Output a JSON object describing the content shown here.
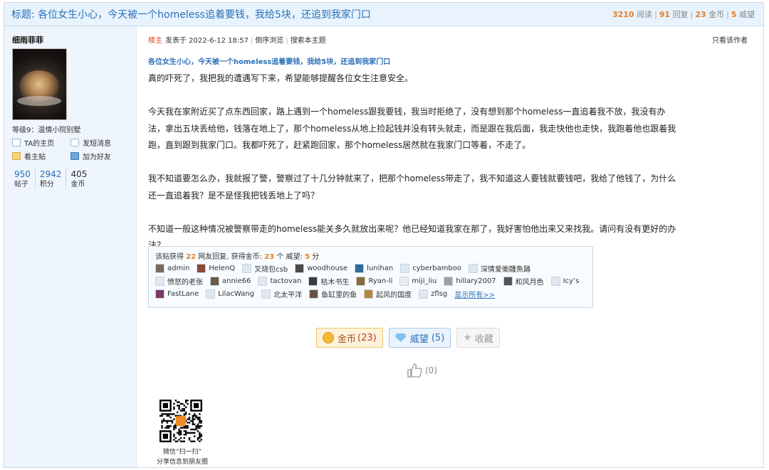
{
  "thread": {
    "title": "标题: 各位女生小心，今天被一个homeless追着要钱，我给5块，还追到我家门口",
    "stats": [
      {
        "num": "3210",
        "label": "阅读"
      },
      {
        "num": "91",
        "label": "回复"
      },
      {
        "num": "23",
        "label": "金币"
      },
      {
        "num": "5",
        "label": "威望"
      }
    ]
  },
  "author": {
    "name": "细雨菲菲",
    "level": "等级9：温情小院别墅",
    "links": [
      "TA的主页",
      "发短消息",
      "看主贴",
      "加为好友"
    ],
    "counts": [
      {
        "num": "950",
        "label": "帖子"
      },
      {
        "num": "2942",
        "label": "积分"
      },
      {
        "num": "405",
        "label": "金币"
      }
    ]
  },
  "post": {
    "floor": "楼主",
    "posted": "发表于 2022-6-12 18:57",
    "reverse": "倒序浏览",
    "search": "搜索本主题",
    "only_author": "只看该作者",
    "subtitle": "各位女生小心，今天被一个homeless追着要钱，我给5块，还追到我家门口",
    "paragraphs": [
      "真的吓死了，我把我的遭遇写下来，希望能够提醒各位女生注意安全。",
      "今天我在家附近买了点东西回家，路上遇到一个homeless跟我要钱，我当时拒绝了，没有想到那个homeless一直追着我不放，我没有办法，拿出五块丢给他，钱落在地上了，那个homeless从地上捡起钱并没有转头就走，而是跟在我后面，我走快他也走快，我跑着他也跟着我跑，直到跟到我家门口。我都吓死了，赶紧跑回家，那个homeless居然就在我家门口等着，不走了。",
      "我不知道要怎么办，我就报了警，警察过了十几分钟就来了，把那个homeless带走了，我不知道这人要钱就要钱吧，我给了他钱了，为什么还一直追着我？是不是怪我把钱丢地上了吗？",
      "不知道一般这种情况被警察带走的homeless能关多久就放出来呢？他已经知道我家在那了，我好害怕他出来又来找我。请问有没有更好的办法？"
    ]
  },
  "rating": {
    "p1": "该贴获得",
    "replies": "22",
    "p2": "网友回复, 获得金币:",
    "gold": "23",
    "p3": "个 威望:",
    "prestige": "5",
    "p4": "分",
    "users": [
      {
        "name": "admin",
        "color": "#7a6a5c"
      },
      {
        "name": "HelenQ",
        "color": "#8b4a3b"
      },
      {
        "name": "叉烧包csb",
        "color": "#dfe8f0"
      },
      {
        "name": "woodhouse",
        "color": "#4a4a4a"
      },
      {
        "name": "lunihan",
        "color": "#2d6b9a"
      },
      {
        "name": "cyberbamboo",
        "color": "#dfe8f0"
      },
      {
        "name": "深情爱衝鸌魚踊",
        "color": "#dfe8f0"
      },
      {
        "name": "愤怒的老张",
        "color": "#dfe8f0"
      },
      {
        "name": "annie66",
        "color": "#6b5a4a"
      },
      {
        "name": "tactovan",
        "color": "#dfe8f0"
      },
      {
        "name": "枯木书生",
        "color": "#3b3b3b"
      },
      {
        "name": "Ryan-li",
        "color": "#8a6a3a"
      },
      {
        "name": "miji_liu",
        "color": "#e8ecef"
      },
      {
        "name": "hillary2007",
        "color": "#9aa3aa"
      },
      {
        "name": "和风月色",
        "color": "#555555"
      },
      {
        "name": "Icy’s",
        "color": "#dfe8f0"
      },
      {
        "name": "FastLane",
        "color": "#7a3a6a"
      },
      {
        "name": "LilacWang",
        "color": "#dfe8f0"
      },
      {
        "name": "北太平洋",
        "color": "#dfe8f0"
      },
      {
        "name": "鱼缸里的鱼",
        "color": "#6a5040"
      },
      {
        "name": "起风的国度",
        "color": "#b08a40"
      },
      {
        "name": "zflsg",
        "color": "#dfe8f0"
      }
    ],
    "show_all": "显示所有>>"
  },
  "actions": {
    "gold_label": "金币",
    "gold_count": "(23)",
    "prestige_label": "威望",
    "prestige_count": "(5)",
    "fav_label": "收藏",
    "like_count": "(0)"
  },
  "qr": {
    "line1": "微信“扫一扫”",
    "line2": "分享信息到朋友圈"
  }
}
